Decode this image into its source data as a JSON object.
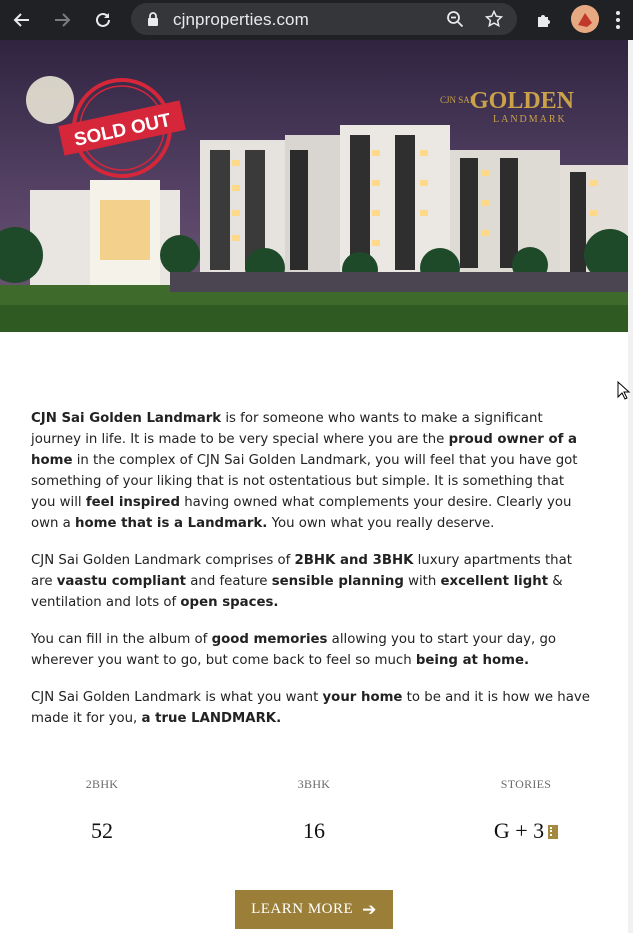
{
  "browser": {
    "url": "cjnproperties.com"
  },
  "hero": {
    "badge": "SOLD OUT",
    "logo_small": "CJN SAI",
    "logo_main": "GOLDEN",
    "logo_sub": "LANDMARK"
  },
  "article": {
    "p1": [
      {
        "t": "CJN Sai Golden Landmark",
        "b": true
      },
      {
        "t": " is for someone who wants to make a significant journey in life. It is made to be very special where you are the ",
        "b": false
      },
      {
        "t": "proud owner of a home",
        "b": true
      },
      {
        "t": " in the complex of CJN Sai Golden Landmark, you will feel that you have got something of your liking that is not ostentatious but simple. It is something that you will ",
        "b": false
      },
      {
        "t": "feel inspired",
        "b": true
      },
      {
        "t": " having owned what complements your desire. Clearly you own a ",
        "b": false
      },
      {
        "t": "home that is a Landmark.",
        "b": true
      },
      {
        "t": " You own what you really deserve.",
        "b": false
      }
    ],
    "p2": [
      {
        "t": "CJN Sai Golden Landmark comprises of ",
        "b": false
      },
      {
        "t": "2BHK and 3BHK",
        "b": true
      },
      {
        "t": " luxury apartments that are ",
        "b": false
      },
      {
        "t": "vaastu compliant",
        "b": true
      },
      {
        "t": " and feature ",
        "b": false
      },
      {
        "t": "sensible planning",
        "b": true
      },
      {
        "t": " with ",
        "b": false
      },
      {
        "t": "excellent light",
        "b": true
      },
      {
        "t": " & ventilation and lots of ",
        "b": false
      },
      {
        "t": "open spaces.",
        "b": true
      }
    ],
    "p3": [
      {
        "t": "You can fill in the album of ",
        "b": false
      },
      {
        "t": "good memories",
        "b": true
      },
      {
        "t": " allowing you to start your day, go wherever you want to go, but come back to feel so much ",
        "b": false
      },
      {
        "t": "being at home.",
        "b": true
      }
    ],
    "p4": [
      {
        "t": "CJN Sai Golden Landmark is what you want ",
        "b": false
      },
      {
        "t": "your home",
        "b": true
      },
      {
        "t": " to be and it is how we have made it for you, ",
        "b": false
      },
      {
        "t": "a true LANDMARK.",
        "b": true
      }
    ]
  },
  "stats": [
    {
      "label": "2BHK",
      "value": "52"
    },
    {
      "label": "3BHK",
      "value": "16"
    },
    {
      "label": "STORIES",
      "value": "G + 3"
    }
  ],
  "cta": {
    "label": "LEARN MORE",
    "arrow": "➔"
  },
  "colors": {
    "chrome_bg": "#202124",
    "omnibox_bg": "#35363a",
    "accent_gold": "#9b7f39",
    "badge_red": "#d6263a"
  }
}
